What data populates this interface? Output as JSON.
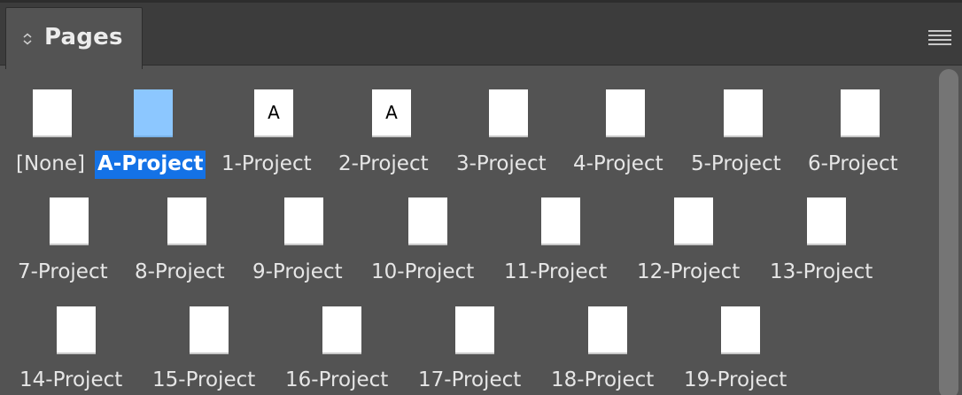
{
  "panel": {
    "title": "Pages"
  },
  "masters": [
    {
      "label": "[None]",
      "prefix": "",
      "selected": false
    },
    {
      "label": "A-Project",
      "prefix": "",
      "selected": true
    },
    {
      "label": "1-Project",
      "prefix": "A",
      "selected": false
    },
    {
      "label": "2-Project",
      "prefix": "A",
      "selected": false
    },
    {
      "label": "3-Project",
      "prefix": "",
      "selected": false
    },
    {
      "label": "4-Project",
      "prefix": "",
      "selected": false
    },
    {
      "label": "5-Project",
      "prefix": "",
      "selected": false
    },
    {
      "label": "6-Project",
      "prefix": "",
      "selected": false
    },
    {
      "label": "7-Project",
      "prefix": "",
      "selected": false
    },
    {
      "label": "8-Project",
      "prefix": "",
      "selected": false
    },
    {
      "label": "9-Project",
      "prefix": "",
      "selected": false
    },
    {
      "label": "10-Project",
      "prefix": "",
      "selected": false
    },
    {
      "label": "11-Project",
      "prefix": "",
      "selected": false
    },
    {
      "label": "12-Project",
      "prefix": "",
      "selected": false
    },
    {
      "label": "13-Project",
      "prefix": "",
      "selected": false
    },
    {
      "label": "14-Project",
      "prefix": "",
      "selected": false
    },
    {
      "label": "15-Project",
      "prefix": "",
      "selected": false
    },
    {
      "label": "16-Project",
      "prefix": "",
      "selected": false
    },
    {
      "label": "17-Project",
      "prefix": "",
      "selected": false
    },
    {
      "label": "18-Project",
      "prefix": "",
      "selected": false
    },
    {
      "label": "19-Project",
      "prefix": "",
      "selected": false
    }
  ],
  "colors": {
    "panel_bg": "#535353",
    "selection": "#1472e6",
    "selected_thumb": "#8cc7ff"
  }
}
